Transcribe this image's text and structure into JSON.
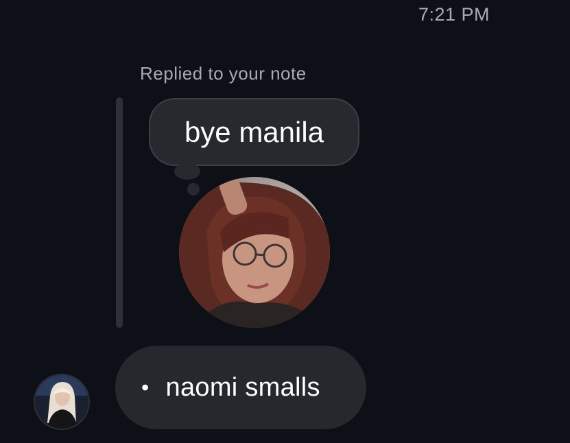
{
  "message_thread": {
    "timestamp": "7:21 PM",
    "reply_context": "Replied to your note",
    "note": {
      "text": "bye manila",
      "avatar_icon": "profile-photo"
    },
    "message": {
      "bullet": "•",
      "text": "naomi smalls",
      "sender_avatar_icon": "profile-photo"
    }
  },
  "colors": {
    "background": "#0d1016",
    "bubble": "#26282e",
    "secondary_text": "#a8abb1",
    "primary_text": "#ffffff"
  }
}
